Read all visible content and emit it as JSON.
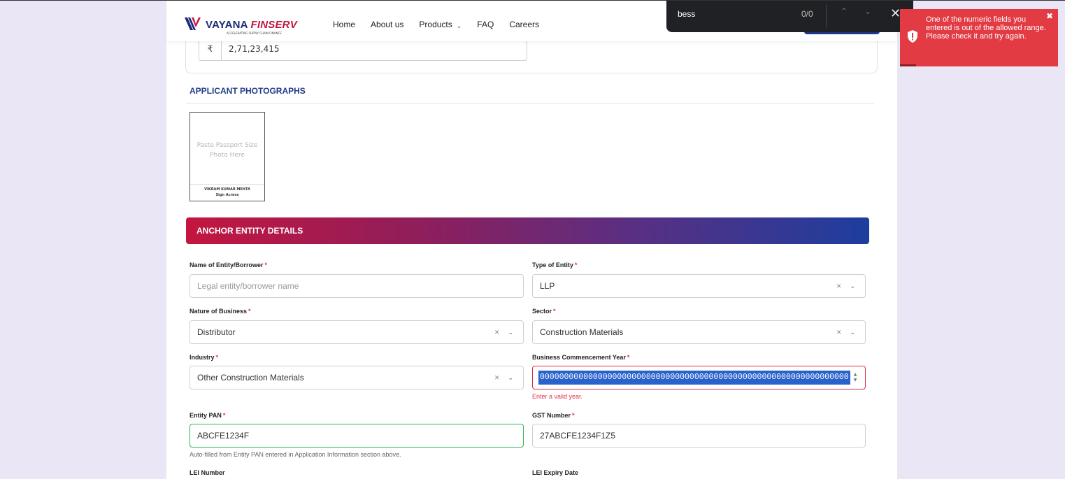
{
  "navbar": {
    "brand_left": "VAYANA",
    "brand_right": "FINSERV",
    "tagline": "ACCELERATING SUPPLY CHAIN FINANCE",
    "links": [
      {
        "label": "Home"
      },
      {
        "label": "About us"
      },
      {
        "label": "Products",
        "has_dropdown": true
      },
      {
        "label": "FAQ"
      },
      {
        "label": "Careers"
      }
    ]
  },
  "find_bar": {
    "query": "bess",
    "count": "0/0"
  },
  "toast": {
    "message": "One of the numeric fields you entered is out of the allowed range. Please check it and try again.",
    "progress": 0.1,
    "color": "#e23b44"
  },
  "prev_section": {
    "currency_symbol": "₹",
    "amount": "2,71,23,415"
  },
  "photographs": {
    "title": "APPLICANT PHOTOGRAPHS",
    "hint": "Paste Passport Size Photo Here",
    "name": "VIKRAM KUMAR MEHTA",
    "sign_note": "Sign Across"
  },
  "anchor": {
    "banner": "ANCHOR ENTITY DETAILS",
    "fields": {
      "entity_name": {
        "label": "Name of Entity/Borrower",
        "required": "*",
        "placeholder": "Legal entity/borrower name",
        "value": ""
      },
      "entity_type": {
        "label": "Type of Entity",
        "required": "*",
        "value": "LLP"
      },
      "nature_of_business": {
        "label": "Nature of Business",
        "required": "*",
        "value": "Distributor"
      },
      "sector": {
        "label": "Sector",
        "required": "*",
        "value": "Construction Materials"
      },
      "industry": {
        "label": "Industry",
        "required": "*",
        "value": "Other Construction Materials"
      },
      "commencement_year": {
        "label": "Business Commencement Year",
        "required": "*",
        "value": "0000000000000000000000000000000000000000000000000000000000000000",
        "error": "Enter a valid year."
      },
      "entity_pan": {
        "label": "Entity PAN",
        "required": "*",
        "value": "ABCFE1234F",
        "help": "Auto-filled from Entity PAN entered in Application Information section above."
      },
      "gst_number": {
        "label": "GST Number",
        "required": "*",
        "value": "27ABCFE1234F1Z5"
      },
      "lei_number": {
        "label": "LEI Number"
      },
      "lei_expiry": {
        "label": "LEI Expiry Date"
      }
    }
  },
  "colors": {
    "background": "#ebe6f5",
    "brand_navy": "#1a2a78",
    "brand_red": "#c4143e",
    "error": "#e0344b",
    "valid": "#2fb45a"
  }
}
